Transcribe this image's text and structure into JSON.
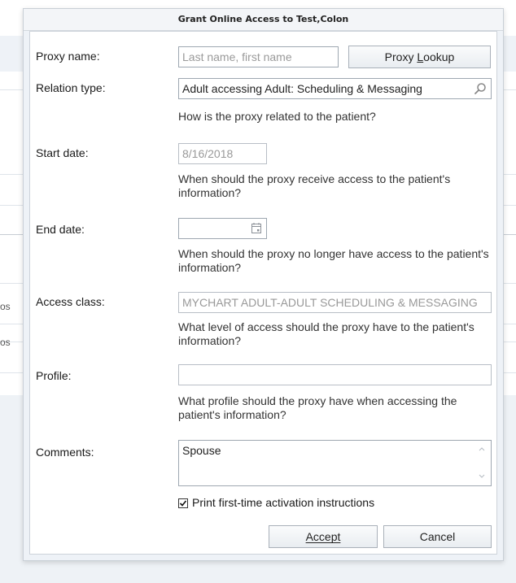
{
  "background": {
    "fragments": [
      "os",
      "os"
    ]
  },
  "dialog": {
    "title": "Grant Online Access to Test,Colon",
    "proxy_name": {
      "label": "Proxy name:",
      "placeholder": "Last name, first name",
      "lookup_button": "Proxy Lookup",
      "lookup_mnemonic": "L"
    },
    "relation_type": {
      "label": "Relation type:",
      "value": "Adult accessing Adult: Scheduling & Messaging",
      "hint": "How is the proxy related to the patient?",
      "icon": "search-icon"
    },
    "start_date": {
      "label": "Start date:",
      "value": "8/16/2018",
      "hint": "When should the proxy receive access to the patient's information?"
    },
    "end_date": {
      "label": "End date:",
      "value": "",
      "hint": "When should the proxy no longer have access to the patient's information?",
      "icon": "calendar-icon"
    },
    "access_class": {
      "label": "Access class:",
      "value": "MYCHART ADULT-ADULT SCHEDULING & MESSAGING",
      "hint": "What level of access should the proxy have to the patient's information?"
    },
    "profile": {
      "label": "Profile:",
      "value": "",
      "hint": "What profile should the proxy have when accessing the patient's information?"
    },
    "comments": {
      "label": "Comments:",
      "value": "Spouse"
    },
    "print_instructions": {
      "label": "Print first-time activation instructions",
      "checked": true
    },
    "buttons": {
      "accept": "Accept",
      "cancel": "Cancel"
    }
  }
}
